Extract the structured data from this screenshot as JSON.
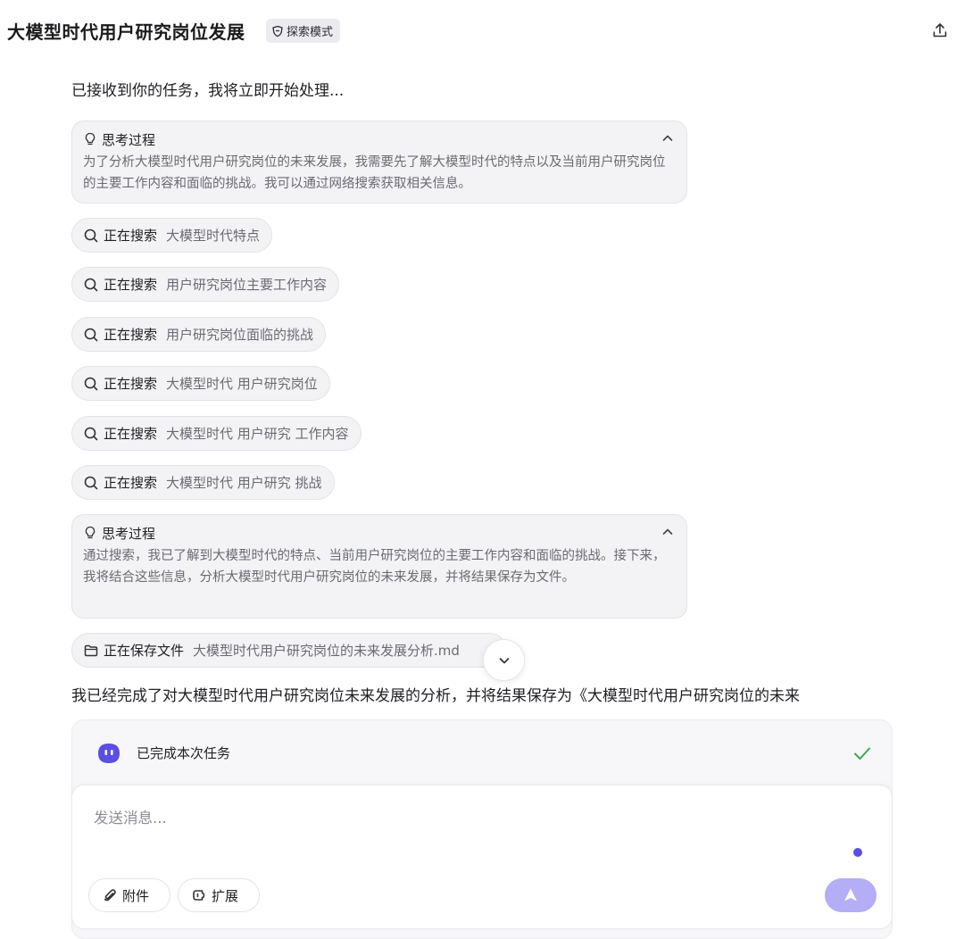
{
  "header": {
    "title": "大模型时代用户研究岗位发展",
    "mode_badge": "探索模式"
  },
  "chat": {
    "intro": "已接收到你的任务，我将立即开始处理...",
    "thinking": [
      {
        "title": "思考过程",
        "text": "为了分析大模型时代用户研究岗位的未来发展，我需要先了解大模型时代的特点以及当前用户研究岗位的主要工作内容和面临的挑战。我可以通过网络搜索获取相关信息。"
      },
      {
        "title": "思考过程",
        "text": "通过搜索，我已了解到大模型时代的特点、当前用户研究岗位的主要工作内容和面临的挑战。接下来，我将结合这些信息，分析大模型时代用户研究岗位的未来发展，并将结果保存为文件。"
      }
    ],
    "search_label": "正在搜索",
    "searches": [
      "大模型时代特点",
      "用户研究岗位主要工作内容",
      "用户研究岗位面临的挑战",
      "大模型时代 用户研究岗位",
      "大模型时代 用户研究 工作内容",
      "大模型时代 用户研究 挑战"
    ],
    "save_label": "正在保存文件",
    "save_file": "大模型时代用户研究岗位的未来发展分析.md",
    "final_text": "我已经完成了对大模型时代用户研究岗位未来发展的分析，并将结果保存为《大模型时代用户研究岗位的未来"
  },
  "status": {
    "label": "已完成本次任务"
  },
  "composer": {
    "placeholder": "发送消息...",
    "attach_label": "附件",
    "expand_label": "扩展"
  },
  "colors": {
    "accent": "#5a4ee3",
    "send_button": "#b3aef5",
    "check": "#3aa757",
    "card_bg": "#f3f3f6"
  }
}
